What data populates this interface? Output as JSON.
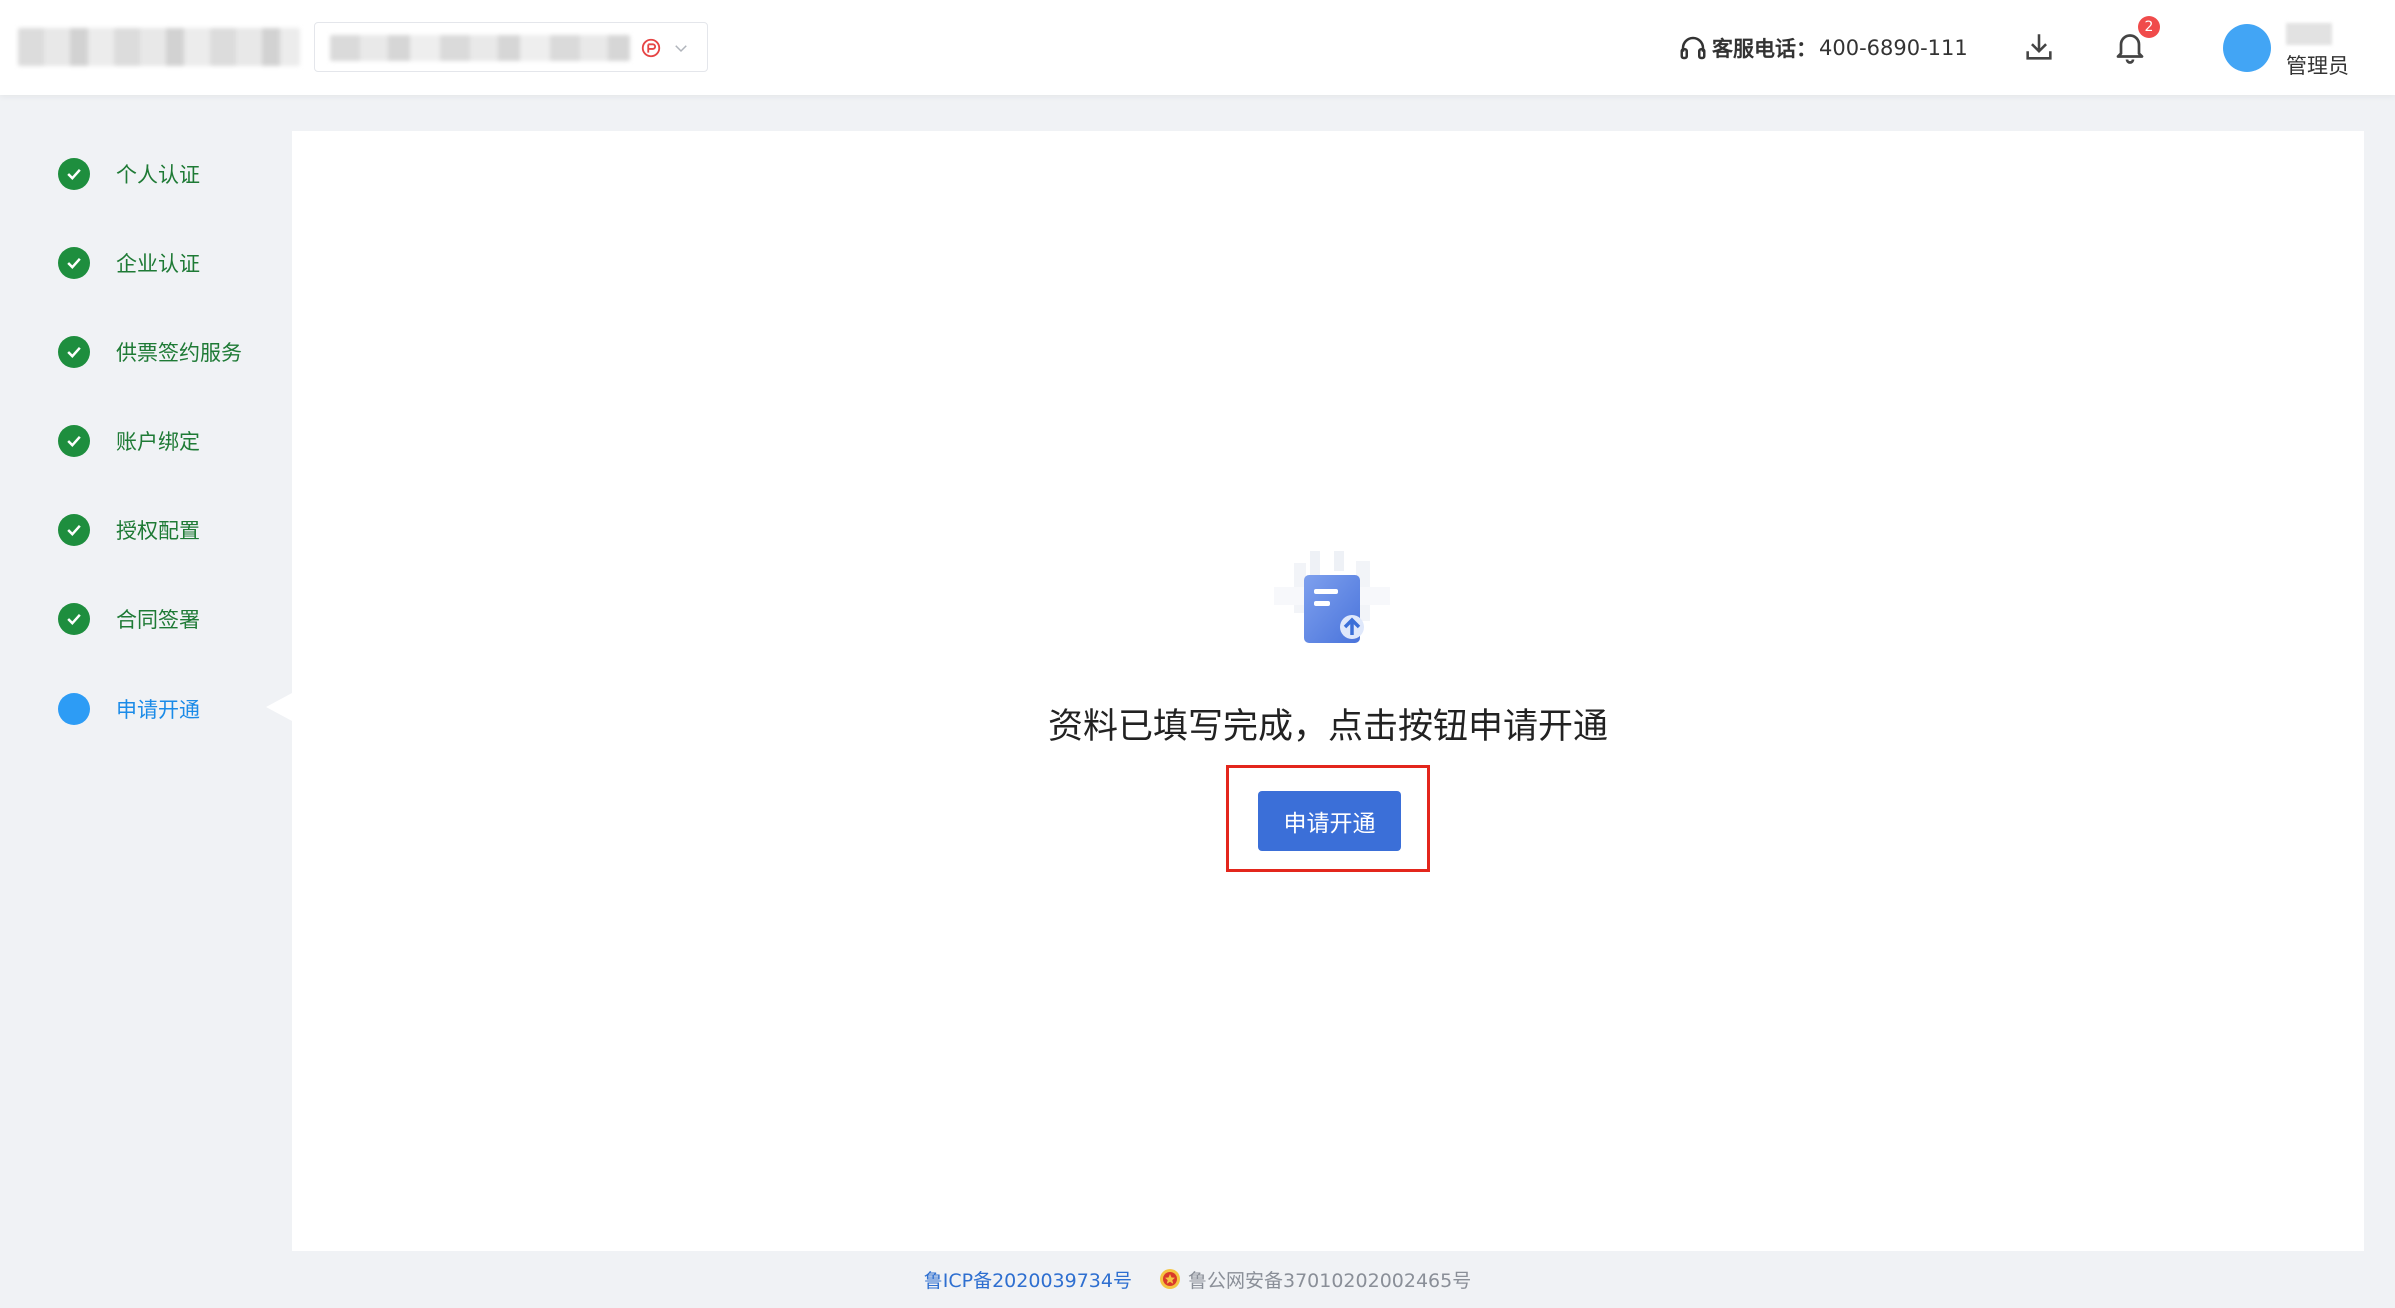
{
  "header": {
    "hotline_label": "客服电话：",
    "hotline_number": "400-6890-111",
    "notification_count": "2",
    "user_role": "管理员",
    "icons": [
      "switch-icon",
      "chevron-down-icon",
      "headset-icon",
      "download-icon",
      "bell-icon"
    ]
  },
  "steps": [
    {
      "label": "个人认证",
      "status": "done"
    },
    {
      "label": "企业认证",
      "status": "done"
    },
    {
      "label": "供票签约服务",
      "status": "done"
    },
    {
      "label": "账户绑定",
      "status": "done"
    },
    {
      "label": "授权配置",
      "status": "done"
    },
    {
      "label": "合同签署",
      "status": "done"
    },
    {
      "label": "申请开通",
      "status": "current"
    }
  ],
  "main": {
    "message": "资料已填写完成，点击按钮申请开通",
    "apply_button_label": "申请开通"
  },
  "footer": {
    "icp": "鲁ICP备2020039734号",
    "police": "鲁公网安备37010202002465号"
  },
  "colors": {
    "step_done": "#1e8e3e",
    "step_current": "#2d9cf5",
    "primary_button": "#3b6fd8",
    "highlight": "#e3261c",
    "badge": "#f04b4b"
  }
}
